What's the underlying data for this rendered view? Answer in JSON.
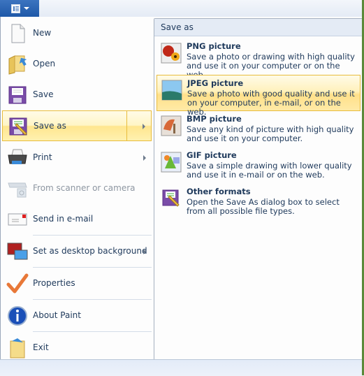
{
  "topbar": {
    "app_button_icon": "paint-menu-icon",
    "dropdown_icon": "chevron-down-icon"
  },
  "left_menu": {
    "items": [
      {
        "label": "New",
        "icon": "new-document-icon",
        "submenu": false,
        "disabled": false
      },
      {
        "label": "Open",
        "icon": "open-folder-icon",
        "submenu": false,
        "disabled": false
      },
      {
        "label": "Save",
        "icon": "floppy-disk-icon",
        "submenu": false,
        "disabled": false
      },
      {
        "label": "Save as",
        "icon": "save-as-icon",
        "submenu": true,
        "disabled": false,
        "highlighted": true
      },
      {
        "label": "Print",
        "icon": "printer-icon",
        "submenu": true,
        "disabled": false
      },
      {
        "label": "From scanner or camera",
        "icon": "scanner-icon",
        "submenu": false,
        "disabled": true
      },
      {
        "label": "Send in e-mail",
        "icon": "email-icon",
        "submenu": false,
        "disabled": false
      },
      {
        "label": "Set as desktop background",
        "icon": "desktop-icon",
        "submenu": true,
        "disabled": false
      },
      {
        "label": "Properties",
        "icon": "checkmark-icon",
        "submenu": false,
        "disabled": false
      },
      {
        "label": "About Paint",
        "icon": "info-icon",
        "submenu": false,
        "disabled": false
      },
      {
        "label": "Exit",
        "icon": "exit-icon",
        "submenu": false,
        "disabled": false
      }
    ]
  },
  "save_as_panel": {
    "title": "Save as",
    "options": [
      {
        "title": "PNG picture",
        "description": "Save a photo or drawing with high quality and use it on your computer or on the web.",
        "icon": "png-picture-icon"
      },
      {
        "title": "JPEG picture",
        "description": "Save a photo with good quality and use it on your computer, in e-mail, or on the web.",
        "icon": "jpeg-picture-icon",
        "highlighted": true
      },
      {
        "title": "BMP picture",
        "description": "Save any kind of picture with high quality and use it on your computer.",
        "icon": "bmp-picture-icon"
      },
      {
        "title": "GIF picture",
        "description": "Save a simple drawing with lower quality and use it in e-mail or on the web.",
        "icon": "gif-picture-icon"
      },
      {
        "title": "Other formats",
        "description": "Open the Save As dialog box to select from all possible file types.",
        "icon": "save-as-icon"
      }
    ]
  }
}
